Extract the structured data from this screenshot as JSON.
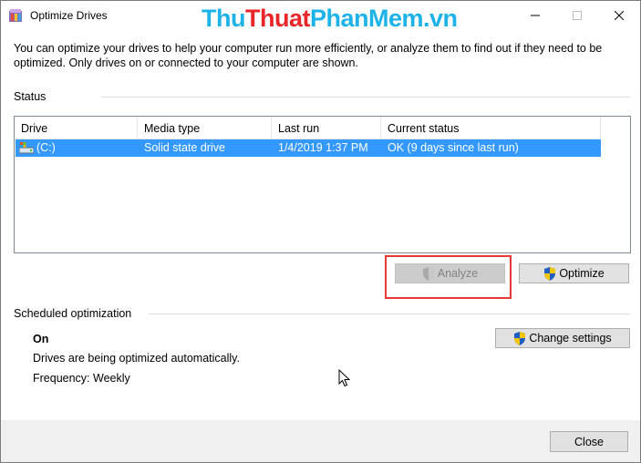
{
  "window": {
    "title": "Optimize Drives",
    "controls": {
      "minimize": "minimize",
      "maximize": "maximize",
      "close": "close"
    }
  },
  "watermark": {
    "part1": "Thu",
    "part2": "Thuat",
    "part3": "PhanMem",
    "part4": ".vn"
  },
  "description": "You can optimize your drives to help your computer run more efficiently, or analyze them to find out if they need to be optimized. Only drives on or connected to your computer are shown.",
  "status": {
    "label": "Status",
    "columns": [
      "Drive",
      "Media type",
      "Last run",
      "Current status"
    ],
    "rows": [
      {
        "drive": "(C:)",
        "media_type": "Solid state drive",
        "last_run": "1/4/2019 1:37 PM",
        "current_status": "OK (9 days since last run)",
        "selected": true
      }
    ],
    "analyze_label": "Analyze",
    "optimize_label": "Optimize"
  },
  "scheduled": {
    "label": "Scheduled optimization",
    "state": "On",
    "detail": "Drives are being optimized automatically.",
    "frequency": "Frequency: Weekly",
    "change_label": "Change settings"
  },
  "footer": {
    "close_label": "Close"
  },
  "colors": {
    "selection": "#3399ff",
    "watermark_blue": "#1db3e8",
    "watermark_red": "#e8262a",
    "highlight": "#e53935",
    "button_face": "#e1e1e1"
  },
  "icons": {
    "app": "defrag-app-icon",
    "drive": "drive-icon",
    "shield": "uac-shield-icon",
    "cursor": "mouse-cursor-icon"
  }
}
